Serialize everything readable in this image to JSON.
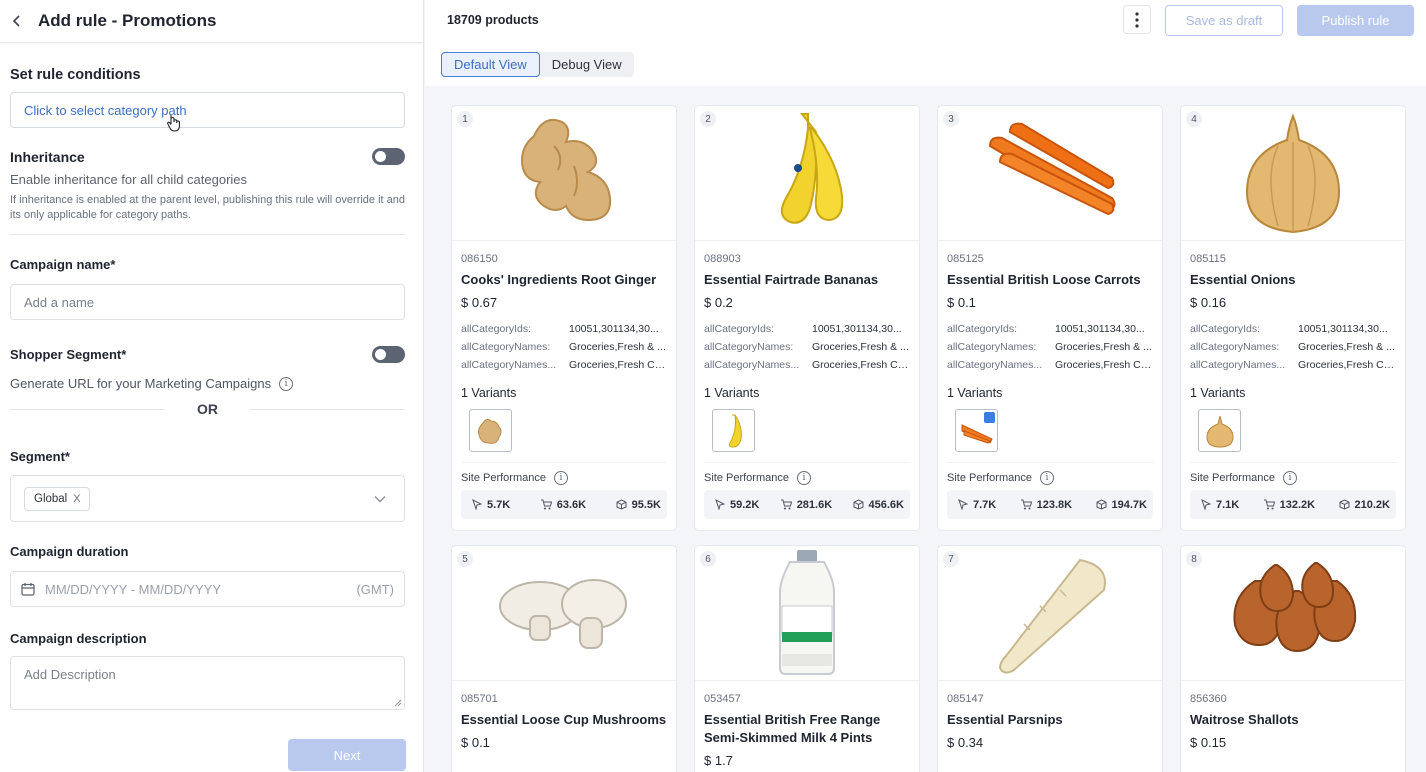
{
  "header": {
    "title": "Add rule - Promotions"
  },
  "conditions": {
    "title": "Set rule conditions",
    "category_path_label": "Click to select category path"
  },
  "inheritance": {
    "title": "Inheritance",
    "subtitle": "Enable inheritance for all child categories",
    "note": "If inheritance is enabled at the parent level, publishing this rule will override it and its only applicable for category paths."
  },
  "campaign_name": {
    "label": "Campaign name*",
    "placeholder": "Add a name"
  },
  "shopper_segment": {
    "label": "Shopper Segment*",
    "url_text": "Generate URL for your Marketing Campaigns"
  },
  "or_label": "OR",
  "segment": {
    "label": "Segment*",
    "chip": "Global",
    "chip_close": "X"
  },
  "campaign_duration": {
    "label": "Campaign duration",
    "placeholder": "MM/DD/YYYY - MM/DD/YYYY",
    "tz": "(GMT)"
  },
  "campaign_description": {
    "label": "Campaign description",
    "placeholder": "Add Description"
  },
  "next_label": "Next",
  "toolbar": {
    "product_count": "18709 products",
    "save_draft": "Save as draft",
    "publish": "Publish rule",
    "views": [
      "Default View",
      "Debug View"
    ]
  },
  "attr_keys": [
    "allCategoryIds:",
    "allCategoryNames:",
    "allCategoryNames..."
  ],
  "site_performance_label": "Site Performance",
  "products": [
    {
      "rank": "1",
      "id": "086150",
      "name": "Cooks' Ingredients Root Ginger",
      "price": "$ 0.67",
      "attrs": [
        "10051,301134,30...",
        "Groceries,Fresh & ...",
        "Groceries,Fresh Ch..."
      ],
      "variants": "1 Variants",
      "perf": [
        "5.7K",
        "63.6K",
        "95.5K"
      ],
      "icon": "ginger"
    },
    {
      "rank": "2",
      "id": "088903",
      "name": "Essential Fairtrade Bananas",
      "price": "$ 0.2",
      "attrs": [
        "10051,301134,30...",
        "Groceries,Fresh & ...",
        "Groceries,Fresh Ch..."
      ],
      "variants": "1 Variants",
      "perf": [
        "59.2K",
        "281.6K",
        "456.6K"
      ],
      "icon": "banana"
    },
    {
      "rank": "3",
      "id": "085125",
      "name": "Essential British Loose Carrots",
      "price": "$ 0.1",
      "attrs": [
        "10051,301134,30...",
        "Groceries,Fresh & ...",
        "Groceries,Fresh Ch..."
      ],
      "variants": "1 Variants",
      "perf": [
        "7.7K",
        "123.8K",
        "194.7K"
      ],
      "icon": "carrot"
    },
    {
      "rank": "4",
      "id": "085115",
      "name": "Essential Onions",
      "price": "$ 0.16",
      "attrs": [
        "10051,301134,30...",
        "Groceries,Fresh & ...",
        "Groceries,Fresh Ch..."
      ],
      "variants": "1 Variants",
      "perf": [
        "7.1K",
        "132.2K",
        "210.2K"
      ],
      "icon": "onion"
    },
    {
      "rank": "5",
      "id": "085701",
      "name": "Essential Loose Cup Mushrooms",
      "price": "$ 0.1",
      "icon": "mushroom"
    },
    {
      "rank": "6",
      "id": "053457",
      "name": "Essential British Free Range Semi-Skimmed Milk 4 Pints",
      "price": "$ 1.7",
      "icon": "milk"
    },
    {
      "rank": "7",
      "id": "085147",
      "name": "Essential Parsnips",
      "price": "$ 0.34",
      "icon": "parsnip"
    },
    {
      "rank": "8",
      "id": "856360",
      "name": "Waitrose Shallots",
      "price": "$ 0.15",
      "icon": "shallot"
    }
  ]
}
